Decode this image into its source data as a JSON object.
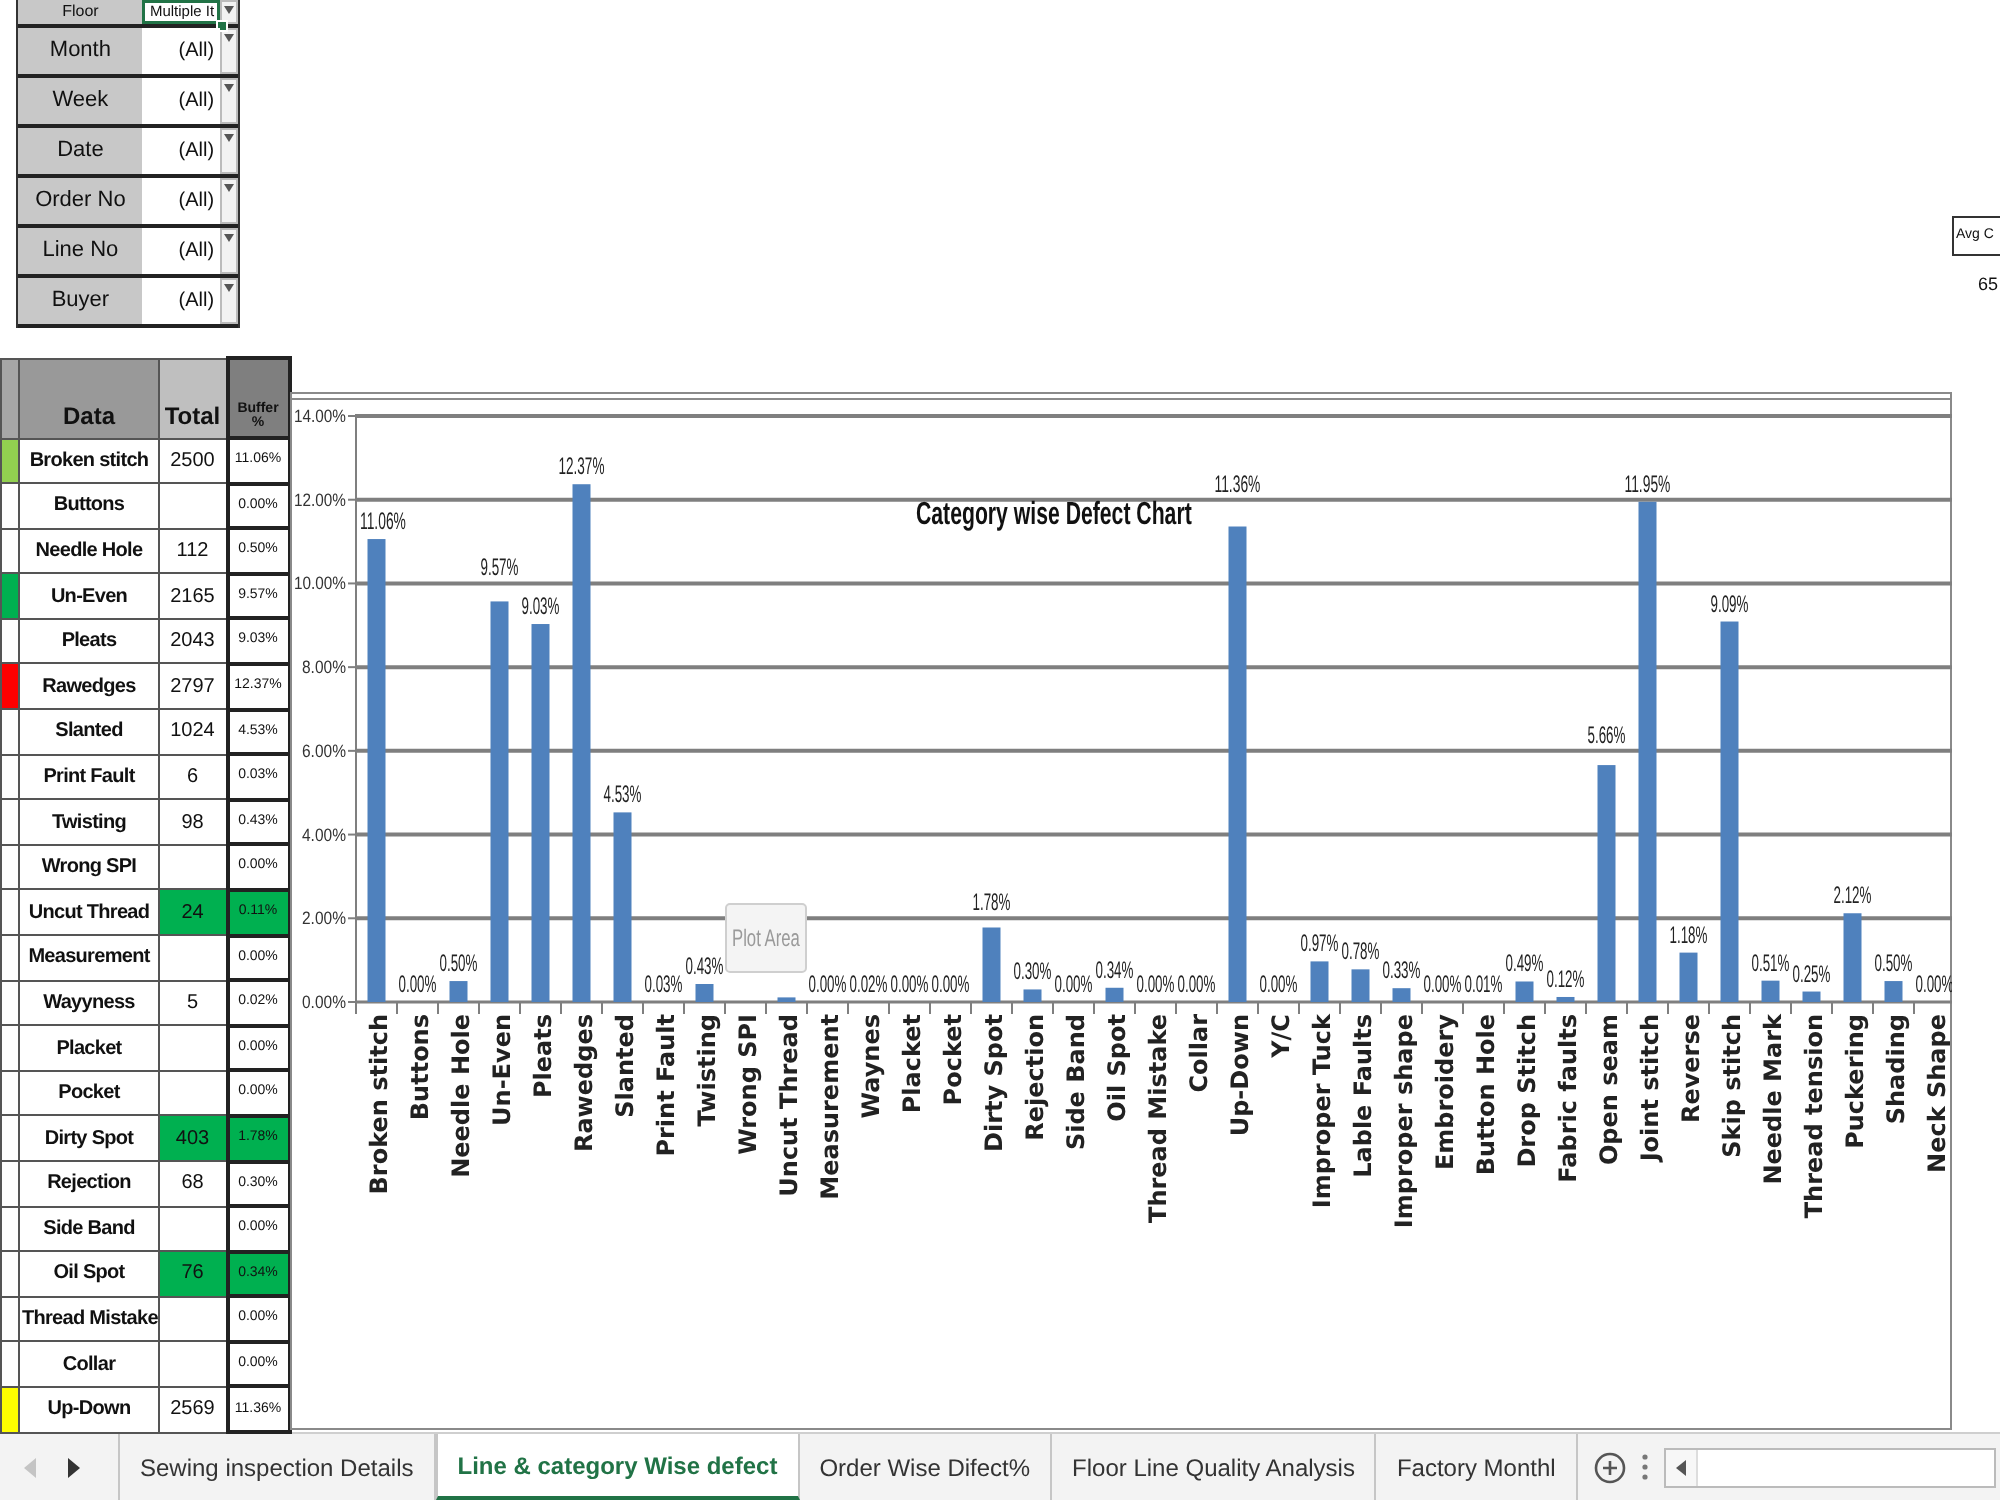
{
  "pivot_filters": [
    {
      "label": "Floor",
      "value": "Multiple It",
      "selected": true
    },
    {
      "label": "Month",
      "value": "(All)",
      "selected": false
    },
    {
      "label": "Week",
      "value": "(All)",
      "selected": false
    },
    {
      "label": "Date",
      "value": "(All)",
      "selected": false
    },
    {
      "label": "Order No",
      "value": "(All)",
      "selected": false
    },
    {
      "label": "Line No",
      "value": "(All)",
      "selected": false
    },
    {
      "label": "Buyer",
      "value": "(All)",
      "selected": false
    }
  ],
  "table": {
    "columns": [
      "Data",
      "Total",
      "Buffer %"
    ],
    "rows": [
      {
        "data": "Broken stitch",
        "total": "2500",
        "buffer": "11.06%",
        "highlight": false,
        "color": "#92d050"
      },
      {
        "data": "Buttons",
        "buffer": "0.00%",
        "highlight": false
      },
      {
        "data": "Needle Hole",
        "total": "112",
        "buffer": "0.50%",
        "highlight": false
      },
      {
        "data": "Un-Even",
        "total": "2165",
        "buffer": "9.57%",
        "highlight": false,
        "color": "#00b050"
      },
      {
        "data": "Pleats",
        "total": "2043",
        "buffer": "9.03%",
        "highlight": false
      },
      {
        "data": "Rawedges",
        "total": "2797",
        "buffer": "12.37%",
        "highlight": false,
        "color": "#ff0000"
      },
      {
        "data": "Slanted",
        "total": "1024",
        "buffer": "4.53%",
        "highlight": false
      },
      {
        "data": "Print Fault",
        "total": "6",
        "buffer": "0.03%",
        "highlight": false
      },
      {
        "data": "Twisting",
        "total": "98",
        "buffer": "0.43%",
        "highlight": false
      },
      {
        "data": "Wrong SPI",
        "buffer": "0.00%",
        "highlight": false
      },
      {
        "data": "Uncut Thread",
        "total": "24",
        "buffer": "0.11%",
        "highlight": true
      },
      {
        "data": "Measurement",
        "buffer": "0.00%",
        "highlight": false
      },
      {
        "data": "Wayyness",
        "total": "5",
        "buffer": "0.02%",
        "highlight": false
      },
      {
        "data": "Placket",
        "buffer": "0.00%",
        "highlight": false
      },
      {
        "data": "Pocket",
        "buffer": "0.00%",
        "highlight": false
      },
      {
        "data": "Dirty Spot",
        "total": "403",
        "buffer": "1.78%",
        "highlight": true
      },
      {
        "data": "Rejection",
        "total": "68",
        "buffer": "0.30%",
        "highlight": false
      },
      {
        "data": "Side Band",
        "buffer": "0.00%",
        "highlight": false
      },
      {
        "data": "Oil Spot",
        "total": "76",
        "buffer": "0.34%",
        "highlight": true
      },
      {
        "data": "Thread Mistake",
        "buffer": "0.00%",
        "highlight": false
      },
      {
        "data": "Collar",
        "buffer": "0.00%",
        "highlight": false
      },
      {
        "data": "Up-Down",
        "total": "2569",
        "buffer": "11.36%",
        "highlight": false,
        "color": "#ffff00"
      }
    ]
  },
  "chart": {
    "tooltip": "Plot Area",
    "chart_data": {
      "type": "bar",
      "title": "Category wise Defect Chart",
      "grid": true,
      "categories": [
        "Broken stitch",
        "Buttons",
        "Needle Hole",
        "Un-Even",
        "Pleats",
        "Rawedges",
        "Slanted",
        "Print Fault",
        "Twisting",
        "Wrong SPI",
        "Uncut Thread",
        "Measurement",
        "Waynes",
        "Placket",
        "Pocket",
        "Dirty Spot",
        "Rejection",
        "Side Band",
        "Oil Spot",
        "Thread Mistake",
        "Collar",
        "Up-Down",
        "Y/C",
        "Improper Tuck",
        "Lable Faults",
        "Improper shape",
        "Embroidery",
        "Button Hole",
        "Drop Stitch",
        "Fabric faults",
        "Open seam",
        "Joint stitch",
        "Reverse",
        "Skip stitch",
        "Needle Mark",
        "Thread tension",
        "Puckering",
        "Shading",
        "Neck Shape"
      ],
      "values": [
        11.06,
        0,
        0.5,
        9.57,
        9.03,
        12.37,
        4.53,
        0.03,
        0.43,
        0,
        0.11,
        0,
        0.02,
        0,
        0,
        1.78,
        0.3,
        0,
        0.34,
        0,
        0,
        11.36,
        0,
        0.97,
        0.78,
        0.33,
        0,
        0.01,
        0.49,
        0.12,
        5.66,
        11.95,
        1.18,
        9.09,
        0.51,
        0.25,
        2.12,
        0.5,
        0
      ],
      "value_labels": [
        "11.06%",
        "0.00%",
        "0.50%",
        "9.57%",
        "9.03%",
        "12.37%",
        "4.53%",
        "0.03%",
        "0.43%",
        null,
        null,
        "0.00%",
        "0.02%",
        "0.00%",
        "0.00%",
        "1.78%",
        "0.30%",
        "0.00%",
        "0.34%",
        "0.00%",
        "0.00%",
        "11.36%",
        "0.00%",
        "0.97%",
        "0.78%",
        "0.33%",
        "0.00%",
        "0.01%",
        "0.49%",
        "0.12%",
        "5.66%",
        "11.95%",
        "1.18%",
        "9.09%",
        "0.51%",
        "0.25%",
        "2.12%",
        "0.50%",
        "0.00%"
      ],
      "ylim": [
        0,
        14
      ],
      "yticks": [
        {
          "value": 0,
          "label": "0.00%"
        },
        {
          "value": 2,
          "label": "2.00%"
        },
        {
          "value": 4,
          "label": "4.00%"
        },
        {
          "value": 6,
          "label": "6.00%"
        },
        {
          "value": 8,
          "label": "8.00%"
        },
        {
          "value": 10,
          "label": "10.00%"
        },
        {
          "value": 12,
          "label": "12.00%"
        },
        {
          "value": 14,
          "label": "14.00%"
        }
      ]
    }
  },
  "side_cells": [
    {
      "text": "Avg C",
      "kind": "header"
    },
    {
      "text": "65",
      "kind": "value"
    }
  ],
  "sheet_nav": [
    {
      "kind": "back",
      "disabled": true
    },
    {
      "kind": "forward",
      "disabled": false
    }
  ],
  "sheet_tabs": [
    {
      "label": "Sewing inspection Details",
      "selected": false
    },
    {
      "label": "Line & category Wise defect",
      "selected": true
    },
    {
      "label": "Order Wise Difect%",
      "selected": false
    },
    {
      "label": "Floor Line Quality Analysis",
      "selected": false
    },
    {
      "label": "Factory Monthl",
      "selected": false
    }
  ]
}
